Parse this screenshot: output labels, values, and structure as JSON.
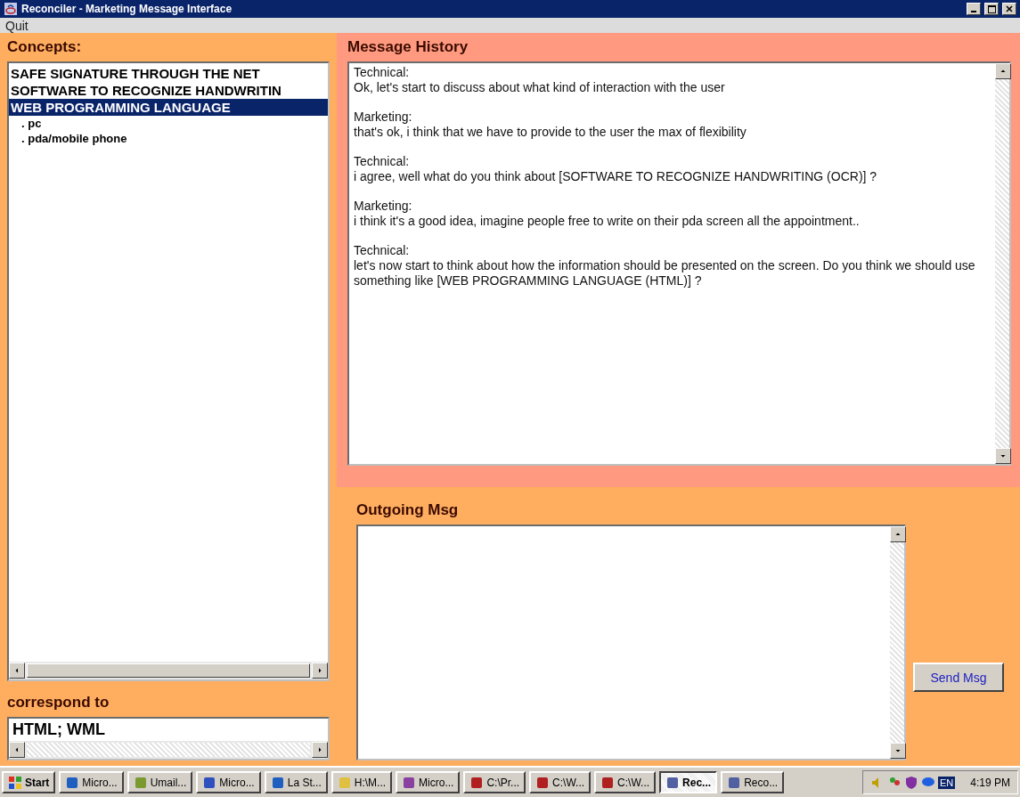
{
  "window": {
    "title": "Reconciler - Marketing Message Interface"
  },
  "menu": [
    "Quit"
  ],
  "concepts": {
    "heading": "Concepts:",
    "items": [
      {
        "label": "SAFE SIGNATURE THROUGH THE NET",
        "selected": false
      },
      {
        "label": "SOFTWARE TO RECOGNIZE HANDWRITIN",
        "selected": false
      },
      {
        "label": "WEB PROGRAMMING LANGUAGE",
        "selected": true,
        "children": [
          {
            "label": ". pc",
            "selected": false
          },
          {
            "label": ". pda/mobile phone",
            "selected": false
          }
        ]
      }
    ]
  },
  "correspond": {
    "heading": "correspond to",
    "value": "HTML; WML"
  },
  "history": {
    "heading": "Message History",
    "messages": [
      {
        "speaker": "Technical:",
        "text": "Ok, let's start to discuss about what kind of interaction with the user"
      },
      {
        "speaker": "Marketing:",
        "text": "that's ok, i think that we have to provide to the user the max of flexibility"
      },
      {
        "speaker": "Technical:",
        "text": "i agree, well what do you think about [SOFTWARE TO RECOGNIZE HANDWRITING (OCR)] ?"
      },
      {
        "speaker": "Marketing:",
        "text": "i think it's a good idea, imagine people free to write on their pda screen all the appointment.."
      },
      {
        "speaker": "Technical:",
        "text": "let's now start to think about how the information should be presented on the screen. Do you think we should use something like [WEB PROGRAMMING LANGUAGE (HTML)] ?"
      }
    ]
  },
  "outgoing": {
    "heading": "Outgoing Msg",
    "send_button": "Send Msg"
  },
  "taskbar": {
    "start": "Start",
    "items": [
      {
        "label": "Micro...",
        "selected": false,
        "color": "#1f5fbf"
      },
      {
        "label": "Umail...",
        "selected": false,
        "color": "#7a9a30"
      },
      {
        "label": "Micro...",
        "selected": false,
        "color": "#3050c0"
      },
      {
        "label": "La St...",
        "selected": false,
        "color": "#1f5fbf"
      },
      {
        "label": "H:\\M...",
        "selected": false,
        "color": "#e0c040"
      },
      {
        "label": "Micro...",
        "selected": false,
        "color": "#8a40a0"
      },
      {
        "label": "C:\\Pr...",
        "selected": false,
        "color": "#b02020"
      },
      {
        "label": "C:\\W...",
        "selected": false,
        "color": "#b02020"
      },
      {
        "label": "C:\\W...",
        "selected": false,
        "color": "#b02020"
      },
      {
        "label": "Rec...",
        "selected": true,
        "color": "#5060a0"
      },
      {
        "label": "Reco...",
        "selected": false,
        "color": "#5060a0"
      }
    ],
    "language": "EN",
    "clock": "4:19 PM"
  }
}
